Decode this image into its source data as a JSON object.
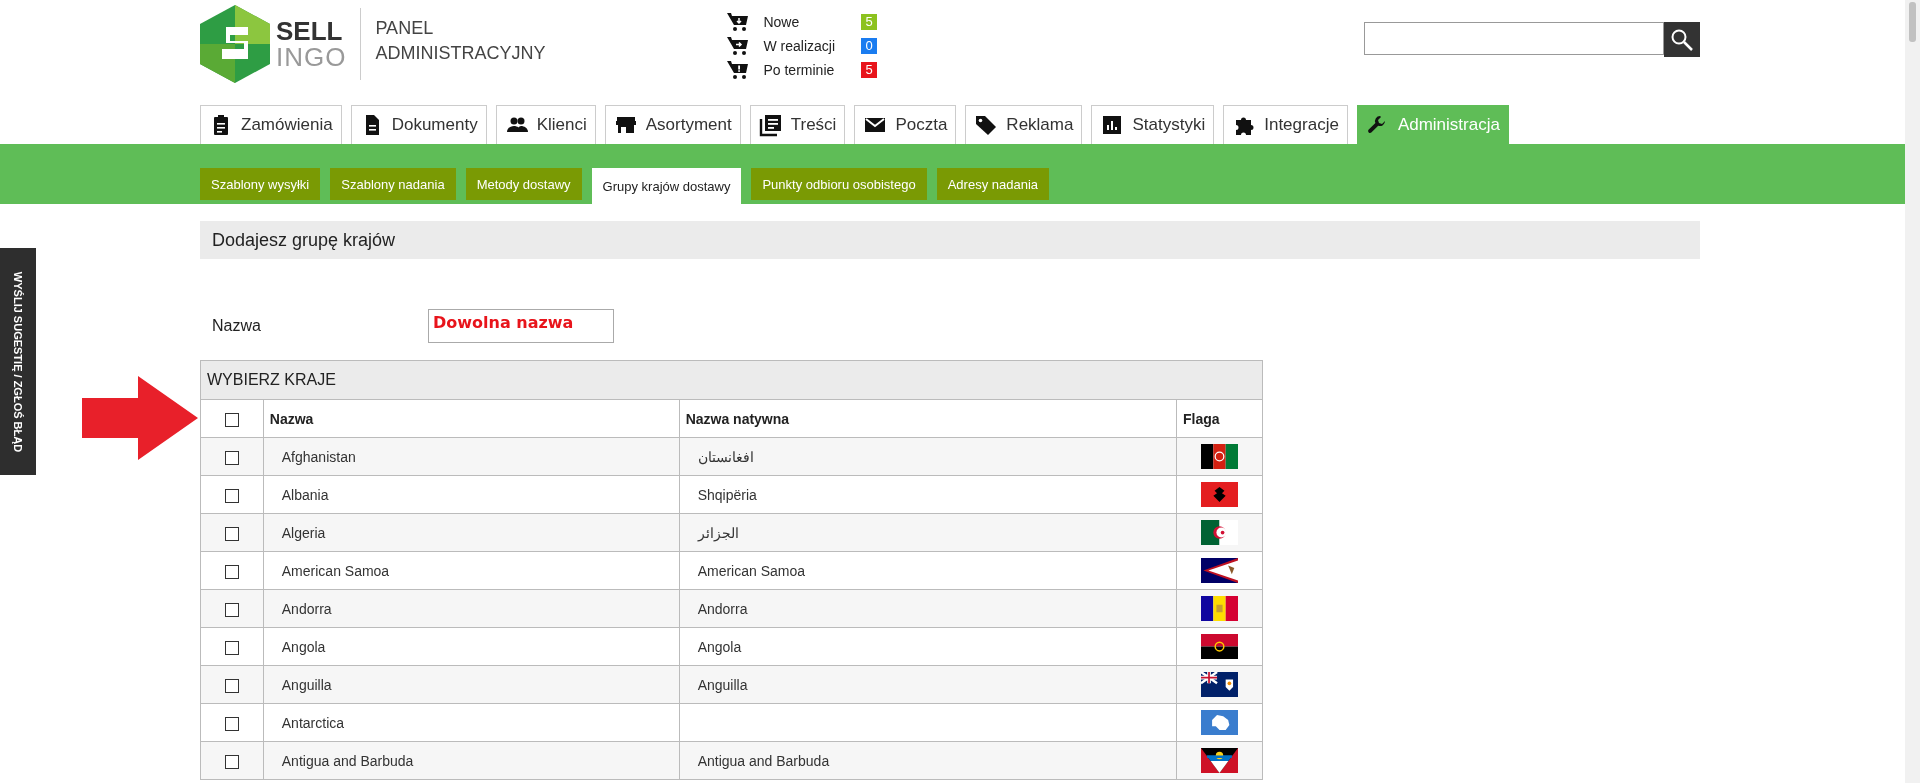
{
  "side_tab": {
    "label": "WYŚLIJ SUGESTIĘ / ZGŁOŚ BŁĄD"
  },
  "logo": {
    "word1": "SELL",
    "word2": "INGO"
  },
  "panel_title": {
    "line1": "PANEL",
    "line2": "ADMINISTRACYJNY"
  },
  "order_status": [
    {
      "label": "Nowe",
      "count": "5",
      "color": "#8cc21f"
    },
    {
      "label": "W realizacji",
      "count": "0",
      "color": "#1a7cf0"
    },
    {
      "label": "Po terminie",
      "count": "5",
      "color": "#e8141b"
    }
  ],
  "tabs": [
    {
      "label": "Zamówienia",
      "selected": false
    },
    {
      "label": "Dokumenty",
      "selected": false
    },
    {
      "label": "Klienci",
      "selected": false
    },
    {
      "label": "Asortyment",
      "selected": false
    },
    {
      "label": "Treści",
      "selected": false
    },
    {
      "label": "Poczta",
      "selected": false
    },
    {
      "label": "Reklama",
      "selected": false
    },
    {
      "label": "Statystyki",
      "selected": false
    },
    {
      "label": "Integracje",
      "selected": false
    },
    {
      "label": "Administracja",
      "selected": true
    }
  ],
  "subtabs": [
    {
      "label": "Szablony wysyłki",
      "selected": false
    },
    {
      "label": "Szablony nadania",
      "selected": false
    },
    {
      "label": "Metody dostawy",
      "selected": false
    },
    {
      "label": "Grupy krajów dostawy",
      "selected": true
    },
    {
      "label": "Punkty odbioru osobistego",
      "selected": false
    },
    {
      "label": "Adresy nadania",
      "selected": false
    }
  ],
  "heading": "Dodajesz grupę krajów",
  "name_field": {
    "label": "Nazwa",
    "value": "Dowolna nazwa"
  },
  "countries": {
    "title": "WYBIERZ KRAJE",
    "columns": [
      "Nazwa",
      "Nazwa natywna",
      "Flaga"
    ],
    "select_all_checked": false,
    "rows": [
      {
        "name": "Afghanistan",
        "native": "افغانستان",
        "kind": "af",
        "checked": false
      },
      {
        "name": "Albania",
        "native": "Shqipëria",
        "kind": "al",
        "checked": false
      },
      {
        "name": "Algeria",
        "native": "الجزائر",
        "kind": "dz",
        "checked": false
      },
      {
        "name": "American Samoa",
        "native": "American Samoa",
        "kind": "as",
        "checked": false
      },
      {
        "name": "Andorra",
        "native": "Andorra",
        "kind": "ad",
        "checked": false
      },
      {
        "name": "Angola",
        "native": "Angola",
        "kind": "ao",
        "checked": false
      },
      {
        "name": "Anguilla",
        "native": "Anguilla",
        "kind": "ai",
        "checked": false
      },
      {
        "name": "Antarctica",
        "kind": "aq",
        "checked": false
      },
      {
        "name": "Antigua and Barbuda",
        "native": "Antigua and Barbuda",
        "kind": "ag",
        "checked": false
      }
    ]
  }
}
